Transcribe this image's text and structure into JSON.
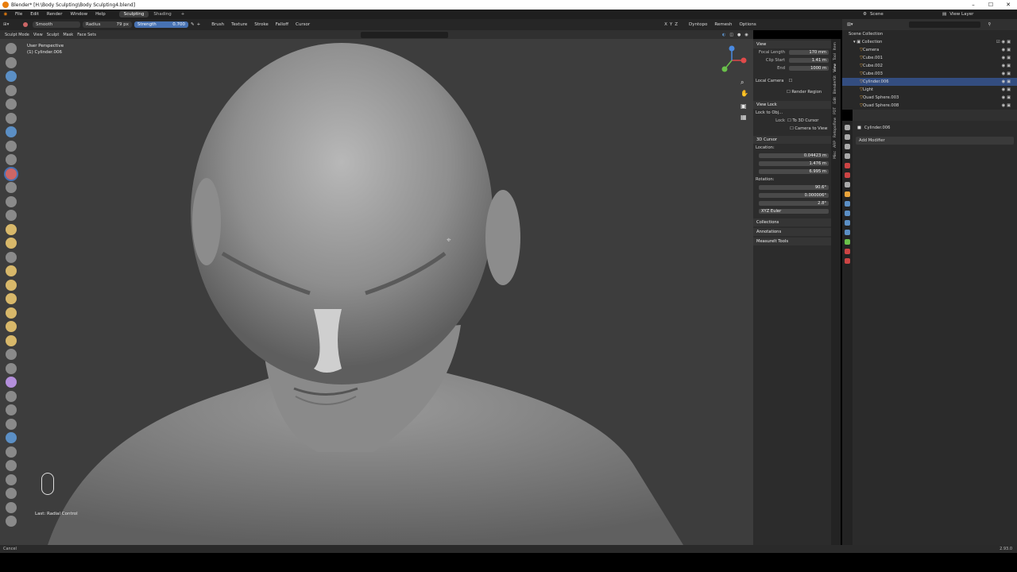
{
  "window": {
    "title": "Blender* [H:\\Body Sculpting\\Body Sculpting4.blend]"
  },
  "menu": {
    "items": [
      "File",
      "Edit",
      "Render",
      "Window",
      "Help"
    ],
    "workspaces": [
      "Sculpting",
      "Shading",
      "+"
    ],
    "scene": "Scene",
    "view_layer": "View Layer"
  },
  "toolheader": {
    "brush": "Smooth",
    "radius_label": "Radius",
    "radius_value": "79 px",
    "strength_label": "Strength",
    "strength_value": "0.700",
    "menus": [
      "Brush",
      "Texture",
      "Stroke",
      "Falloff",
      "Cursor"
    ],
    "dyntopo": "Dyntopo",
    "remesh": "Remesh",
    "options": "Options",
    "axes": [
      "X",
      "Y",
      "Z"
    ]
  },
  "vpheader": {
    "mode": "Sculpt Mode",
    "menus": [
      "View",
      "Sculpt",
      "Mask",
      "Face Sets"
    ]
  },
  "viewport": {
    "perspective": "User Perspective",
    "object": "(1) Cylinder.006",
    "last_op": "Last: Radial Control"
  },
  "npanel": {
    "view_header": "View",
    "focal_length_label": "Focal Length",
    "focal_length": "170 mm",
    "clip_start_label": "Clip Start",
    "clip_start": "1.41 m",
    "clip_end_label": "End",
    "clip_end": "1000 m",
    "local_camera": "Local Camera",
    "render_region": "Render Region",
    "view_lock": "View Lock",
    "lock_to_obj": "Lock to Obj...",
    "lock_label": "Lock",
    "to_3d_cursor": "To 3D Cursor",
    "camera_to_view": "Camera to View",
    "cursor_header": "3D Cursor",
    "location_label": "Location:",
    "loc_x": "0.04423 m",
    "loc_y": "1.476 m",
    "loc_z": "6.995 m",
    "rotation_label": "Rotation:",
    "rot_x": "90.6°",
    "rot_y": "0.000006°",
    "rot_z": "2.8°",
    "rot_mode": "XYZ Euler",
    "collections": "Collections",
    "annotations": "Annotations",
    "measureit": "MeasureIt Tools",
    "tabs": [
      "Item",
      "Tool",
      "View",
      "BlenderKit",
      "Edit",
      "PDT",
      "Retopoflow",
      "ARP",
      "Misc"
    ]
  },
  "outliner": {
    "scene_collection": "Scene Collection",
    "collection": "Collection",
    "items": [
      {
        "name": "Camera",
        "selected": false
      },
      {
        "name": "Cube.001",
        "selected": false
      },
      {
        "name": "Cube.002",
        "selected": false
      },
      {
        "name": "Cube.003",
        "selected": false
      },
      {
        "name": "Cylinder.006",
        "selected": true
      },
      {
        "name": "Light",
        "selected": false
      },
      {
        "name": "Quad Sphere.003",
        "selected": false
      },
      {
        "name": "Quad Sphere.008",
        "selected": false
      }
    ]
  },
  "properties": {
    "object": "Cylinder.006",
    "add_modifier": "Add Modifier"
  },
  "status": {
    "left": "Cancel",
    "right": "2.93.0"
  }
}
